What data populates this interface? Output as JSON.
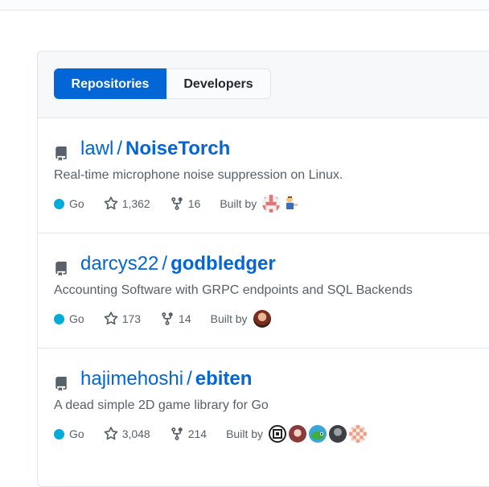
{
  "tabs": [
    {
      "label": "Repositories",
      "selected": true
    },
    {
      "label": "Developers",
      "selected": false
    }
  ],
  "colors": {
    "accent": "#0366d6",
    "go_language": "#00add8"
  },
  "repos": [
    {
      "owner": "lawl",
      "name": "NoiseTorch",
      "description": "Real-time microphone noise suppression on Linux.",
      "language": "Go",
      "stars": "1,362",
      "forks": "16",
      "built_by_label": "Built by",
      "avatars": [
        "identicon-avatar",
        "cartoon-figure-avatar"
      ]
    },
    {
      "owner": "darcys22",
      "name": "godbledger",
      "description": "Accounting Software with GRPC endpoints and SQL Backends",
      "language": "Go",
      "stars": "173",
      "forks": "14",
      "built_by_label": "Built by",
      "avatars": [
        "photo-avatar"
      ]
    },
    {
      "owner": "hajimehoshi",
      "name": "ebiten",
      "description": "A dead simple 2D game library for Go",
      "language": "Go",
      "stars": "3,048",
      "forks": "214",
      "built_by_label": "Built by",
      "avatars": [
        "logo-avatar",
        "anime-avatar",
        "chameleon-avatar",
        "photo-avatar",
        "identicon-avatar"
      ]
    }
  ]
}
